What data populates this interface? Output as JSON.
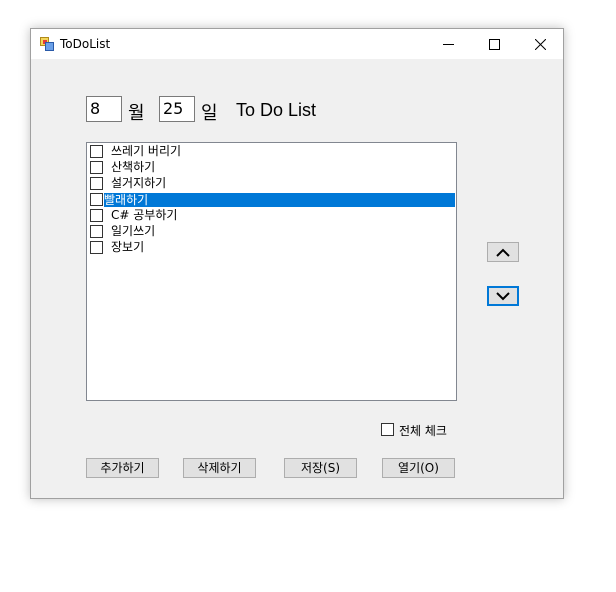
{
  "window": {
    "title": "ToDoList"
  },
  "date": {
    "month_value": "8",
    "month_label": "월",
    "day_value": "25",
    "day_label": "일",
    "heading": "To Do List"
  },
  "list": {
    "items": [
      {
        "label": "쓰레기 버리기",
        "checked": false,
        "selected": false
      },
      {
        "label": "산책하기",
        "checked": false,
        "selected": false
      },
      {
        "label": "설거지하기",
        "checked": false,
        "selected": false
      },
      {
        "label": "빨래하기",
        "checked": false,
        "selected": true
      },
      {
        "label": "C# 공부하기",
        "checked": false,
        "selected": false
      },
      {
        "label": "일기쓰기",
        "checked": false,
        "selected": false
      },
      {
        "label": "장보기",
        "checked": false,
        "selected": false
      }
    ]
  },
  "controls": {
    "move_up_icon": "chevron-up-icon",
    "move_down_icon": "chevron-down-icon",
    "check_all_label": "전체 체크",
    "add_label": "추가하기",
    "delete_label": "삭제하기",
    "save_label": "저장(S)",
    "open_label": "열기(O)"
  },
  "colors": {
    "selection": "#0078d7",
    "window_bg": "#f0f0f0"
  }
}
